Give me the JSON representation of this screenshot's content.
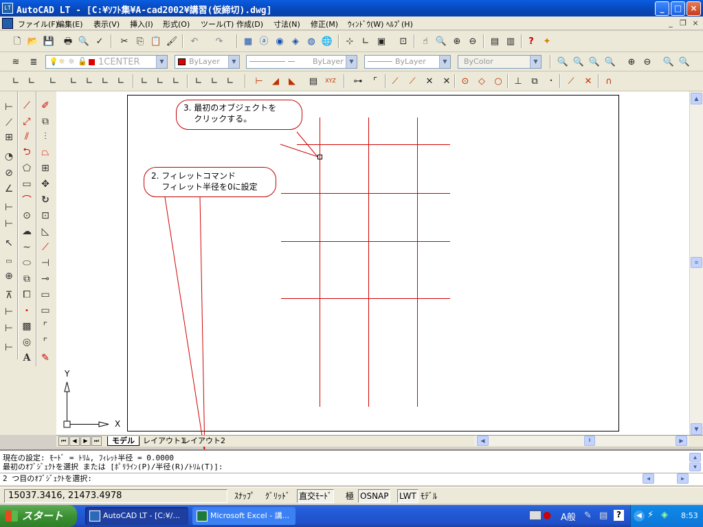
{
  "window": {
    "app_icon_label": "LT",
    "title": "AutoCAD LT - [C:¥ｿﾌﾄ集¥A-cad2002¥講習(仮締切).dwg]",
    "buttons": [
      "minimize",
      "maximize",
      "close"
    ]
  },
  "menu": {
    "items": [
      "ファイル(F)",
      "編集(E)",
      "表示(V)",
      "挿入(I)",
      "形式(O)",
      "ツール(T)",
      "作成(D)",
      "寸法(N)",
      "修正(M)",
      "ｳｨﾝﾄﾞｳ(W)",
      "ﾍﾙﾌﾟ(H)"
    ]
  },
  "layer_toolbar": {
    "layer_name": "1CENTER",
    "color_value": "ByLayer",
    "linetype_value": "ByLayer",
    "lineweight_value": "ByLayer",
    "plotstyle_value": "ByColor"
  },
  "annotations": {
    "step3": "3. 最初のオブジェクトを\n    クリックする。",
    "step2": "2. フィレットコマンド\n    フィレット半径を0に設定"
  },
  "ucs": {
    "y_label": "Y",
    "x_label": "X"
  },
  "layout_tabs": [
    "モデル",
    "レイアウト1",
    "レイアウト2"
  ],
  "command_window": {
    "line1": "現在の設定: ﾓｰﾄﾞ = ﾄﾘﾑ, ﾌｨﾚｯﾄ半径 = 0.0000",
    "line2": "最初のｵﾌﾞｼﾞｪｸﾄを選択 または [ﾎﾟﾘﾗｲﾝ(P)/半径(R)/ﾄﾘﾑ(T)]:",
    "line3": "2 つ目のｵﾌﾞｼﾞｪｸﾄを選択:"
  },
  "status": {
    "coordinates": "15037.3416, 21473.4978",
    "toggles": [
      "ｽﾅｯﾌﾟ",
      "ｸﾞﾘｯﾄﾞ",
      "直交ﾓｰﾄﾞ",
      "極",
      "OSNAP",
      "LWT",
      "ﾓﾃﾞﾙ"
    ],
    "toggles_on": [
      "直交ﾓｰﾄﾞ",
      "OSNAP",
      "LWT"
    ]
  },
  "taskbar": {
    "start_label": "スタート",
    "tasks": [
      "AutoCAD LT - [C:¥/...",
      "Microsoft Excel - 講..."
    ],
    "ime_label": "A般",
    "clock": "8:53"
  },
  "colors": {
    "grid_lines": "#d00000",
    "callout_border": "#c00000",
    "title_bar": "#0a5ce0"
  }
}
